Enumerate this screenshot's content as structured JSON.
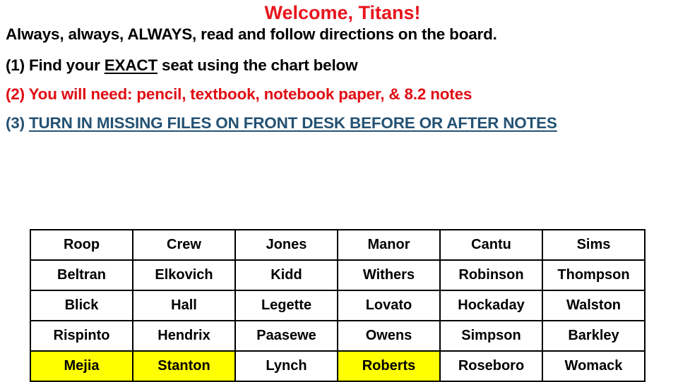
{
  "title": "Welcome, Titans!",
  "lines": {
    "intro": "Always, always, ALWAYS, read and follow directions on the board.",
    "step1_prefix": "(1) Find your ",
    "step1_emphasis": "EXACT",
    "step1_suffix": " seat using the chart below",
    "step2": "(2) You will need: pencil, textbook, notebook paper, & 8.2 notes",
    "step3_prefix": "(3) ",
    "step3_text": "TURN IN MISSING FILES ON FRONT DESK BEFORE OR AFTER NOTES"
  },
  "colors": {
    "title": "#e8141c",
    "step2": "#e00d14",
    "step3": "#245274",
    "highlight": "#ffff00"
  },
  "seating_chart": {
    "rows": [
      [
        {
          "name": "Roop"
        },
        {
          "name": "Crew"
        },
        {
          "name": "Jones"
        },
        {
          "name": "Manor"
        },
        {
          "name": "Cantu"
        },
        {
          "name": "Sims"
        }
      ],
      [
        {
          "name": "Beltran"
        },
        {
          "name": "Elkovich"
        },
        {
          "name": "Kidd"
        },
        {
          "name": "Withers"
        },
        {
          "name": "Robinson"
        },
        {
          "name": "Thompson"
        }
      ],
      [
        {
          "name": "Blick"
        },
        {
          "name": "Hall"
        },
        {
          "name": "Legette"
        },
        {
          "name": "Lovato"
        },
        {
          "name": "Hockaday"
        },
        {
          "name": "Walston"
        }
      ],
      [
        {
          "name": "Rispinto"
        },
        {
          "name": "Hendrix"
        },
        {
          "name": "Paasewe"
        },
        {
          "name": "Owens"
        },
        {
          "name": "Simpson"
        },
        {
          "name": "Barkley"
        }
      ],
      [
        {
          "name": "Mejia",
          "highlighted": true
        },
        {
          "name": "Stanton",
          "highlighted": true
        },
        {
          "name": "Lynch"
        },
        {
          "name": "Roberts",
          "highlighted": true
        },
        {
          "name": "Roseboro"
        },
        {
          "name": "Womack"
        }
      ]
    ]
  }
}
